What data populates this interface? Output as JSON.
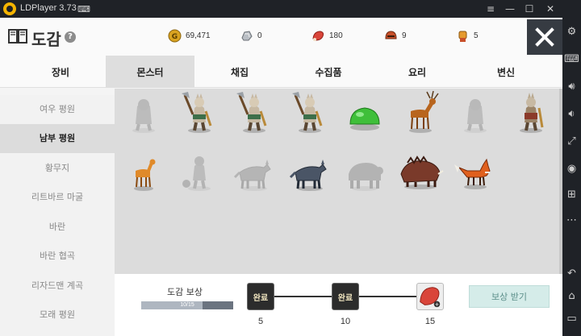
{
  "emulator": {
    "title": "LDPlayer 3.73",
    "window_buttons": [
      "≡",
      "—",
      "☐",
      "✕"
    ],
    "side_buttons": [
      "gear-icon",
      "keyboard-icon",
      "volume-up-icon",
      "volume-down-icon",
      "fullscreen-icon",
      "record-icon",
      "add-icon",
      "more-icon",
      "back-icon",
      "home-icon",
      "recent-icon"
    ]
  },
  "header": {
    "title": "도감",
    "help": "?",
    "resources": [
      {
        "name": "gold",
        "value": "69,471",
        "color": "#d9a320"
      },
      {
        "name": "silver",
        "value": "0",
        "color": "#9aa0a6"
      },
      {
        "name": "meat",
        "value": "180",
        "color": "#d9453a"
      },
      {
        "name": "helmet",
        "value": "9",
        "color": "#c8502a"
      },
      {
        "name": "fist",
        "value": "5",
        "color": "#e59a2e"
      }
    ]
  },
  "tabs": [
    {
      "label": "장비",
      "active": false
    },
    {
      "label": "몬스터",
      "active": true
    },
    {
      "label": "채집",
      "active": false
    },
    {
      "label": "수집품",
      "active": false
    },
    {
      "label": "요리",
      "active": false
    },
    {
      "label": "변신",
      "active": false
    }
  ],
  "regions": [
    {
      "label": "여우 평원",
      "active": false
    },
    {
      "label": "남부 평원",
      "active": true
    },
    {
      "label": "황무지",
      "active": false
    },
    {
      "label": "리트바르 마굴",
      "active": false
    },
    {
      "label": "바란",
      "active": false
    },
    {
      "label": "바란 협곡",
      "active": false
    },
    {
      "label": "리자드맨 계곡",
      "active": false
    },
    {
      "label": "모래 평원",
      "active": false
    }
  ],
  "monsters": [
    {
      "kind": "gnoll",
      "locked": true
    },
    {
      "kind": "gnoll-axe",
      "locked": false
    },
    {
      "kind": "gnoll-axe",
      "locked": false
    },
    {
      "kind": "gnoll-axe",
      "locked": false
    },
    {
      "kind": "slime",
      "locked": false
    },
    {
      "kind": "deer",
      "locked": false
    },
    {
      "kind": "gnoll",
      "locked": true
    },
    {
      "kind": "gnoll-warrior",
      "locked": false
    },
    {
      "kind": "fawn",
      "locked": false
    },
    {
      "kind": "gnoll-ball",
      "locked": true
    },
    {
      "kind": "wolf",
      "locked": true
    },
    {
      "kind": "wolf",
      "locked": false
    },
    {
      "kind": "bear",
      "locked": true
    },
    {
      "kind": "boar",
      "locked": false
    },
    {
      "kind": "fox",
      "locked": false
    }
  ],
  "reward": {
    "label": "도감 보상",
    "progress_text": "10/15",
    "progress": 0.667,
    "milestones": [
      {
        "value": "5",
        "status": "완료"
      },
      {
        "value": "10",
        "status": "완료"
      },
      {
        "value": "15",
        "status": ""
      }
    ],
    "claim_label": "보상 받기"
  }
}
